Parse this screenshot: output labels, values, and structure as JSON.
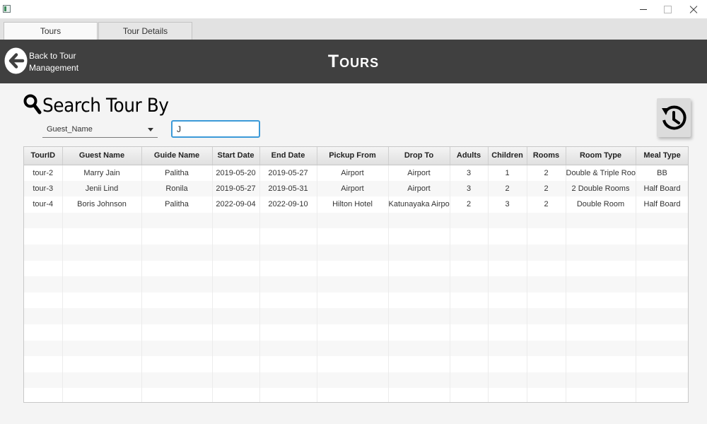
{
  "window": {
    "icon": "app-icon",
    "controls": [
      "minimize-icon",
      "maximize-icon",
      "close-icon"
    ]
  },
  "tabs": [
    {
      "label": "Tours",
      "selected": true
    },
    {
      "label": "Tour Details",
      "selected": false
    }
  ],
  "header": {
    "back_label_line1": "Back to Tour",
    "back_label_line2": "Management",
    "back_icon": "arrow-left-icon",
    "title": "Tours"
  },
  "search": {
    "heading": "Search Tour By",
    "heading_icon": "search-icon",
    "field_selected": "Guest_Name",
    "query_value": "J",
    "refresh_icon": "history-icon"
  },
  "table": {
    "columns": [
      "TourID",
      "Guest Name",
      "Guide Name",
      "Start Date",
      "End Date",
      "Pickup From",
      "Drop To",
      "Adults",
      "Children",
      "Rooms",
      "Room Type",
      "Meal Type"
    ],
    "rows": [
      [
        "tour-2",
        "Marry Jain",
        "Palitha",
        "2019-05-20",
        "2019-05-27",
        "Airport",
        "Airport",
        "3",
        "1",
        "2",
        "Double & Triple Room",
        "BB"
      ],
      [
        "tour-3",
        "Jenii Lind",
        "Ronila",
        "2019-05-27",
        "2019-05-31",
        "Airport",
        "Airport",
        "3",
        "2",
        "2",
        "2 Double Rooms",
        "Half Board"
      ],
      [
        "tour-4",
        "Boris Johnson",
        "Palitha",
        "2022-09-04",
        "2022-09-10",
        "Hilton Hotel",
        "Katunayaka Airport",
        "2",
        "3",
        "2",
        "Double Room",
        "Half Board"
      ]
    ],
    "empty_rows": 12
  },
  "colors": {
    "header_bg": "#404040",
    "focus_accent": "#3c9ad8"
  }
}
